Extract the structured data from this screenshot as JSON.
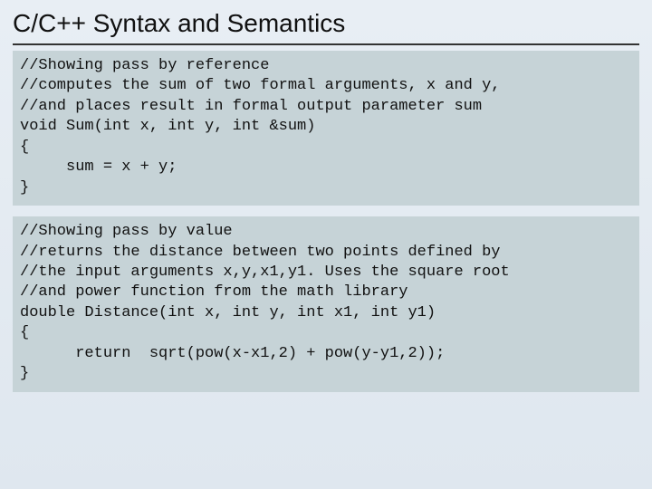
{
  "title": "C/C++ Syntax and Semantics",
  "code1": "//Showing pass by reference\n//computes the sum of two formal arguments, x and y,\n//and places result in formal output parameter sum\nvoid Sum(int x, int y, int &sum)\n{\n     sum = x + y;\n}",
  "code2": "//Showing pass by value\n//returns the distance between two points defined by\n//the input arguments x,y,x1,y1. Uses the square root\n//and power function from the math library\ndouble Distance(int x, int y, int x1, int y1)\n{\n      return  sqrt(pow(x-x1,2) + pow(y-y1,2));\n}"
}
